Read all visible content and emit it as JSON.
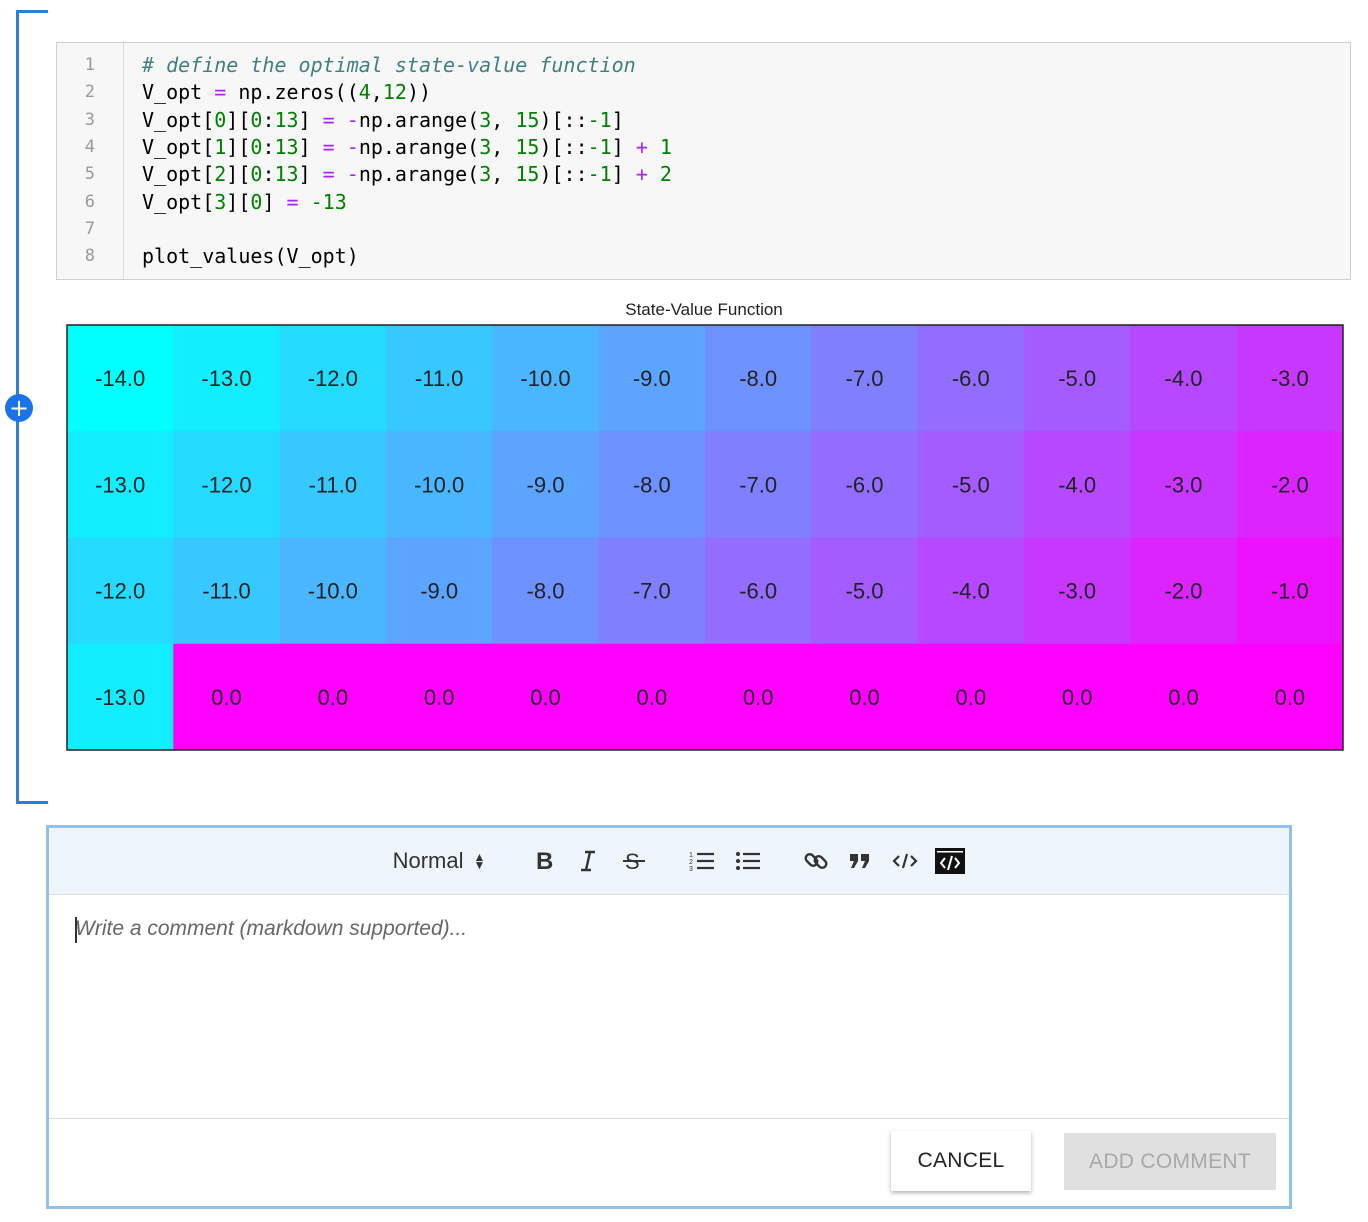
{
  "code": {
    "lines": [
      [
        {
          "t": "# define the optimal state-value function",
          "c": "comment"
        }
      ],
      [
        {
          "t": "V_opt ",
          "c": ""
        },
        {
          "t": "=",
          "c": "op"
        },
        {
          "t": " np.zeros((",
          "c": ""
        },
        {
          "t": "4",
          "c": "num"
        },
        {
          "t": ",",
          "c": ""
        },
        {
          "t": "12",
          "c": "num"
        },
        {
          "t": "))",
          "c": ""
        }
      ],
      [
        {
          "t": "V_opt[",
          "c": ""
        },
        {
          "t": "0",
          "c": "num"
        },
        {
          "t": "][",
          "c": ""
        },
        {
          "t": "0",
          "c": "num"
        },
        {
          "t": ":",
          "c": ""
        },
        {
          "t": "13",
          "c": "num"
        },
        {
          "t": "] ",
          "c": ""
        },
        {
          "t": "=",
          "c": "op"
        },
        {
          "t": " ",
          "c": ""
        },
        {
          "t": "-",
          "c": "op"
        },
        {
          "t": "np.arange(",
          "c": ""
        },
        {
          "t": "3",
          "c": "num"
        },
        {
          "t": ", ",
          "c": ""
        },
        {
          "t": "15",
          "c": "num"
        },
        {
          "t": ")[::",
          "c": ""
        },
        {
          "t": "-1",
          "c": "num"
        },
        {
          "t": "]",
          "c": ""
        }
      ],
      [
        {
          "t": "V_opt[",
          "c": ""
        },
        {
          "t": "1",
          "c": "num"
        },
        {
          "t": "][",
          "c": ""
        },
        {
          "t": "0",
          "c": "num"
        },
        {
          "t": ":",
          "c": ""
        },
        {
          "t": "13",
          "c": "num"
        },
        {
          "t": "] ",
          "c": ""
        },
        {
          "t": "=",
          "c": "op"
        },
        {
          "t": " ",
          "c": ""
        },
        {
          "t": "-",
          "c": "op"
        },
        {
          "t": "np.arange(",
          "c": ""
        },
        {
          "t": "3",
          "c": "num"
        },
        {
          "t": ", ",
          "c": ""
        },
        {
          "t": "15",
          "c": "num"
        },
        {
          "t": ")[::",
          "c": ""
        },
        {
          "t": "-1",
          "c": "num"
        },
        {
          "t": "] ",
          "c": ""
        },
        {
          "t": "+",
          "c": "op"
        },
        {
          "t": " ",
          "c": ""
        },
        {
          "t": "1",
          "c": "num"
        }
      ],
      [
        {
          "t": "V_opt[",
          "c": ""
        },
        {
          "t": "2",
          "c": "num"
        },
        {
          "t": "][",
          "c": ""
        },
        {
          "t": "0",
          "c": "num"
        },
        {
          "t": ":",
          "c": ""
        },
        {
          "t": "13",
          "c": "num"
        },
        {
          "t": "] ",
          "c": ""
        },
        {
          "t": "=",
          "c": "op"
        },
        {
          "t": " ",
          "c": ""
        },
        {
          "t": "-",
          "c": "op"
        },
        {
          "t": "np.arange(",
          "c": ""
        },
        {
          "t": "3",
          "c": "num"
        },
        {
          "t": ", ",
          "c": ""
        },
        {
          "t": "15",
          "c": "num"
        },
        {
          "t": ")[::",
          "c": ""
        },
        {
          "t": "-1",
          "c": "num"
        },
        {
          "t": "] ",
          "c": ""
        },
        {
          "t": "+",
          "c": "op"
        },
        {
          "t": " ",
          "c": ""
        },
        {
          "t": "2",
          "c": "num"
        }
      ],
      [
        {
          "t": "V_opt[",
          "c": ""
        },
        {
          "t": "3",
          "c": "num"
        },
        {
          "t": "][",
          "c": ""
        },
        {
          "t": "0",
          "c": "num"
        },
        {
          "t": "] ",
          "c": ""
        },
        {
          "t": "=",
          "c": "op"
        },
        {
          "t": " ",
          "c": ""
        },
        {
          "t": "-13",
          "c": "num"
        }
      ],
      [],
      [
        {
          "t": "plot_values(V_opt)",
          "c": ""
        }
      ]
    ],
    "line_numbers": [
      "1",
      "2",
      "3",
      "4",
      "5",
      "6",
      "7",
      "8"
    ]
  },
  "chart_data": {
    "type": "heatmap",
    "title": "State-Value Function",
    "colormap": "cool",
    "vmin": -14,
    "vmax": 0,
    "rows": 4,
    "cols": 12,
    "values": [
      [
        -14,
        -13,
        -12,
        -11,
        -10,
        -9,
        -8,
        -7,
        -6,
        -5,
        -4,
        -3
      ],
      [
        -13,
        -12,
        -11,
        -10,
        -9,
        -8,
        -7,
        -6,
        -5,
        -4,
        -3,
        -2
      ],
      [
        -12,
        -11,
        -10,
        -9,
        -8,
        -7,
        -6,
        -5,
        -4,
        -3,
        -2,
        -1
      ],
      [
        -13,
        0,
        0,
        0,
        0,
        0,
        0,
        0,
        0,
        0,
        0,
        0
      ]
    ]
  },
  "add_cell": {
    "icon": "plus-icon"
  },
  "comment": {
    "format_label": "Normal",
    "placeholder": "Write a comment (markdown supported)...",
    "cancel_label": "CANCEL",
    "add_label": "ADD COMMENT",
    "toolbar_icons": [
      "bold-icon",
      "italic-icon",
      "strikethrough-icon",
      "ordered-list-icon",
      "bullet-list-icon",
      "link-icon",
      "quote-icon",
      "code-icon",
      "code-block-icon"
    ]
  },
  "colors": {
    "accent": "#2a7fd4",
    "comment_border": "#90c0ee",
    "toolbar_bg": "#eef5fd"
  }
}
